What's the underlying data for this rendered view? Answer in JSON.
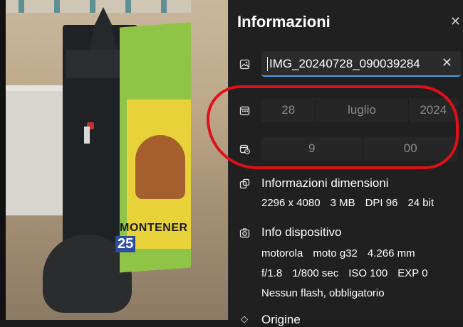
{
  "panel": {
    "title": "Informazioni",
    "filename": "IMG_20240728_090039284",
    "date": {
      "day": "28",
      "month": "luglio",
      "year": "2024"
    },
    "time": {
      "hour": "9",
      "minute": "00"
    },
    "dimensions": {
      "label": "Informazioni dimensioni",
      "values": [
        "2296 x 4080",
        "3 MB",
        "DPI 96",
        "24 bit"
      ]
    },
    "device": {
      "label": "Info dispositivo",
      "line1": [
        "motorola",
        "moto g32",
        "4.266 mm"
      ],
      "line2": [
        "f/1.8",
        "1/800 sec",
        "ISO 100",
        "EXP 0"
      ],
      "line3": "Nessun flash, obbligatorio"
    },
    "next_section_partial": "Origine"
  },
  "photo_sign": {
    "text": "MONTENER",
    "number": "25"
  },
  "colors": {
    "accent": "#4a9ce3",
    "annotation": "#e0101a",
    "panel_bg": "#202020"
  }
}
